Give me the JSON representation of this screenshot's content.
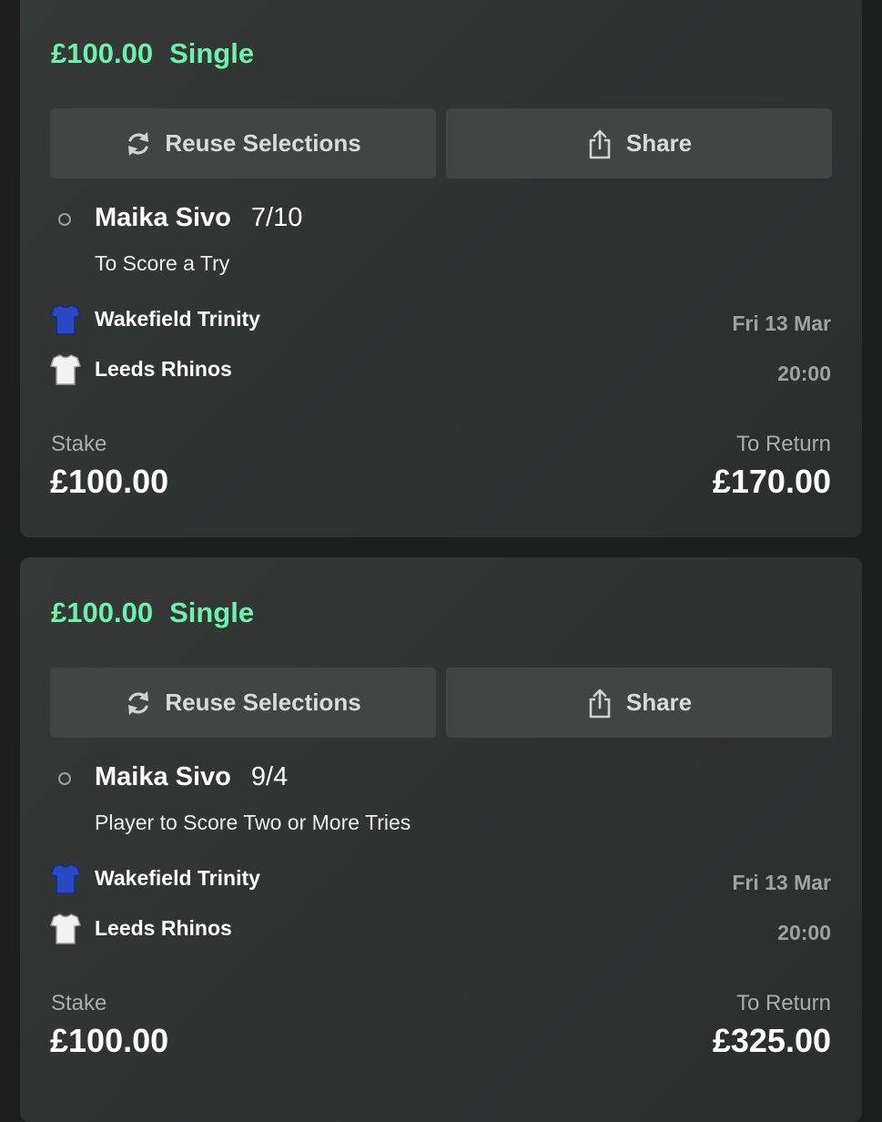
{
  "bets": [
    {
      "header": {
        "amount": "£100.00",
        "type": "Single"
      },
      "actions": {
        "reuse_label": "Reuse Selections",
        "share_label": "Share"
      },
      "selection": {
        "name": "Maika Sivo",
        "odds": "7/10",
        "market": "To Score a Try"
      },
      "event": {
        "home_team": "Wakefield Trinity",
        "away_team": "Leeds Rhinos",
        "date": "Fri 13 Mar",
        "time": "20:00"
      },
      "footer": {
        "stake_label": "Stake",
        "stake_value": "£100.00",
        "return_label": "To Return",
        "return_value": "£170.00"
      }
    },
    {
      "header": {
        "amount": "£100.00",
        "type": "Single"
      },
      "actions": {
        "reuse_label": "Reuse Selections",
        "share_label": "Share"
      },
      "selection": {
        "name": "Maika Sivo",
        "odds": "9/4",
        "market": "Player to Score Two or More Tries"
      },
      "event": {
        "home_team": "Wakefield Trinity",
        "away_team": "Leeds Rhinos",
        "date": "Fri 13 Mar",
        "time": "20:00"
      },
      "footer": {
        "stake_label": "Stake",
        "stake_value": "£100.00",
        "return_label": "To Return",
        "return_value": "£325.00"
      }
    }
  ],
  "icons": {
    "reuse": "refresh-icon",
    "share": "share-icon",
    "selection_status": "radio-circle-icon",
    "home_kit": "blue-shirt-icon",
    "away_kit": "white-shirt-icon"
  },
  "colors": {
    "accent_green": "#6ff0ae",
    "card_bg": "#313534",
    "button_bg": "#414644",
    "home_kit_blue": "#2a47c4",
    "away_kit_white": "#f2f2f2"
  }
}
